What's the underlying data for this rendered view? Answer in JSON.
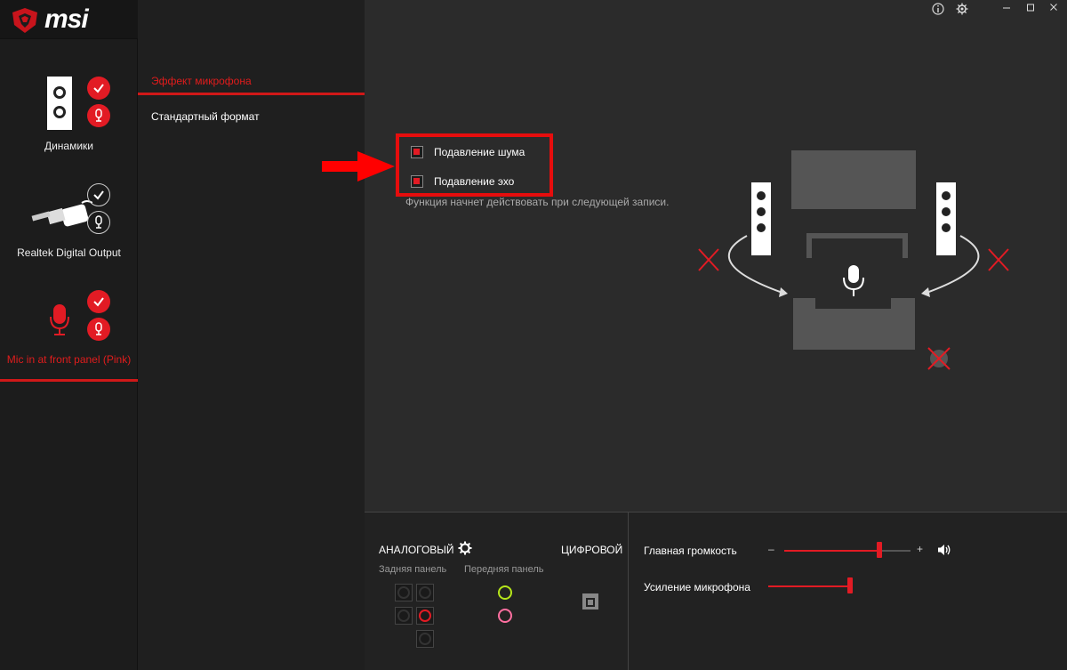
{
  "app": {
    "brand": "msi"
  },
  "devices": [
    {
      "label": "Динамики",
      "active": false
    },
    {
      "label": "Realtek Digital Output",
      "active": false
    },
    {
      "label": "Mic in at front panel (Pink)",
      "active": true
    }
  ],
  "menu": {
    "items": [
      {
        "label": "Эффект микрофона",
        "active": true
      },
      {
        "label": "Стандартный формат",
        "active": false
      }
    ]
  },
  "effects": {
    "noise_suppression": {
      "label": "Подавление шума",
      "checked": true
    },
    "echo_cancellation": {
      "label": "Подавление эхо",
      "checked": true
    },
    "note": "Функция начнет действовать при следующей записи."
  },
  "bottom": {
    "analog_label": "АНАЛОГОВЫЙ",
    "digital_label": "ЦИФРОВОЙ",
    "rear_panel_label": "Задняя панель",
    "front_panel_label": "Передняя панель",
    "master_volume_label": "Главная громкость",
    "mic_boost_label": "Усиление микрофона",
    "minus": "–",
    "plus": "+",
    "master_volume_value": 0.75,
    "mic_boost_value": 1.0
  },
  "colors": {
    "accent": "#e21b24",
    "front_green": "#b6e61a",
    "front_pink": "#ff6fa0"
  },
  "icons": [
    "info-icon",
    "settings-icon",
    "minimize-icon",
    "maximize-icon",
    "close-icon",
    "gear-icon",
    "speaker-volume-icon",
    "optical-port-icon",
    "red-arrow-icon",
    "microphone-icon",
    "check-icon"
  ]
}
